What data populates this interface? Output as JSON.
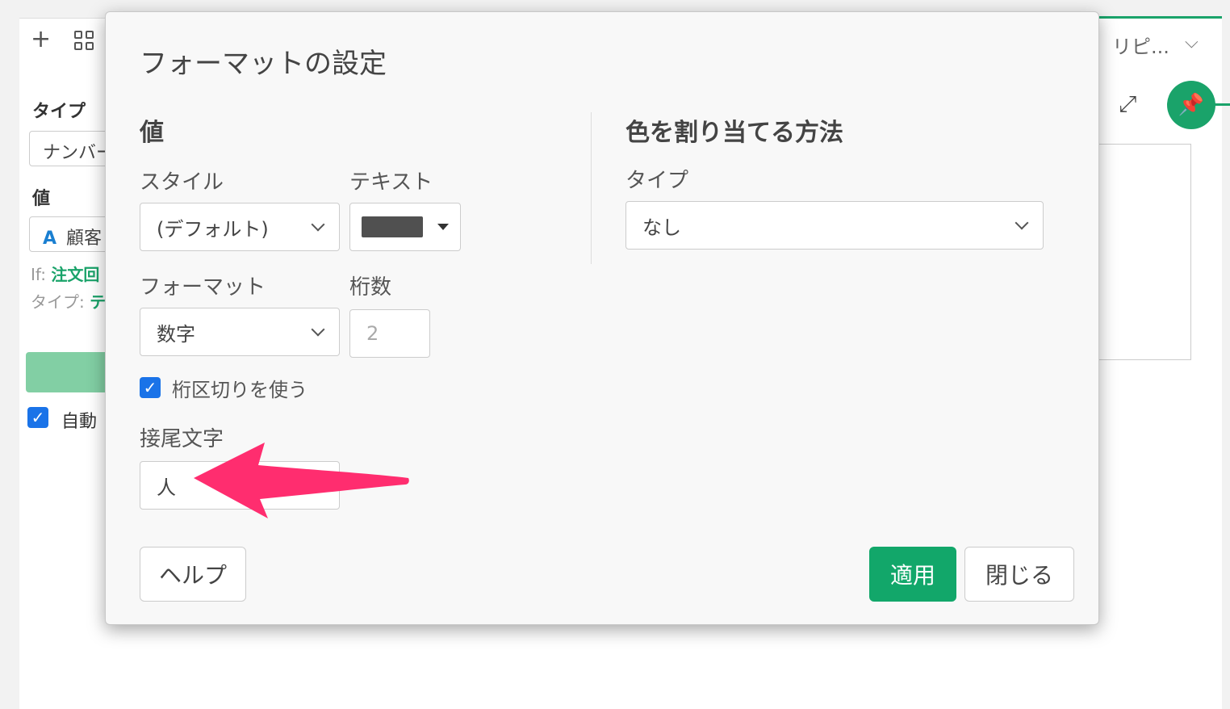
{
  "background": {
    "tab_label": "リピ...",
    "sidebar": {
      "type_label": "タイプ",
      "type_value": "ナンバー",
      "value_label": "値",
      "value_field_icon": "A",
      "value_field_text": "顧客",
      "if_prefix": "If:",
      "if_value": "注文回",
      "type_prefix": "タイプ:",
      "type_value_short": "テ",
      "auto_label": "自動"
    }
  },
  "dialog": {
    "title": "フォーマットの設定",
    "value_section": {
      "heading": "値",
      "style_label": "スタイル",
      "style_value": "(デフォルト)",
      "text_label": "テキスト",
      "text_color": "#505050",
      "format_label": "フォーマット",
      "format_value": "数字",
      "digits_label": "桁数",
      "digits_placeholder": "2",
      "separator_label": "桁区切りを使う",
      "separator_checked": true,
      "suffix_label": "接尾文字",
      "suffix_value": "人"
    },
    "color_section": {
      "heading": "色を割り当てる方法",
      "type_label": "タイプ",
      "type_value": "なし"
    },
    "buttons": {
      "help": "ヘルプ",
      "apply": "適用",
      "close": "閉じる"
    }
  },
  "colors": {
    "accent_green": "#12a76a",
    "annotation_arrow": "#ff2d6f",
    "checkbox_blue": "#1a73e8"
  }
}
